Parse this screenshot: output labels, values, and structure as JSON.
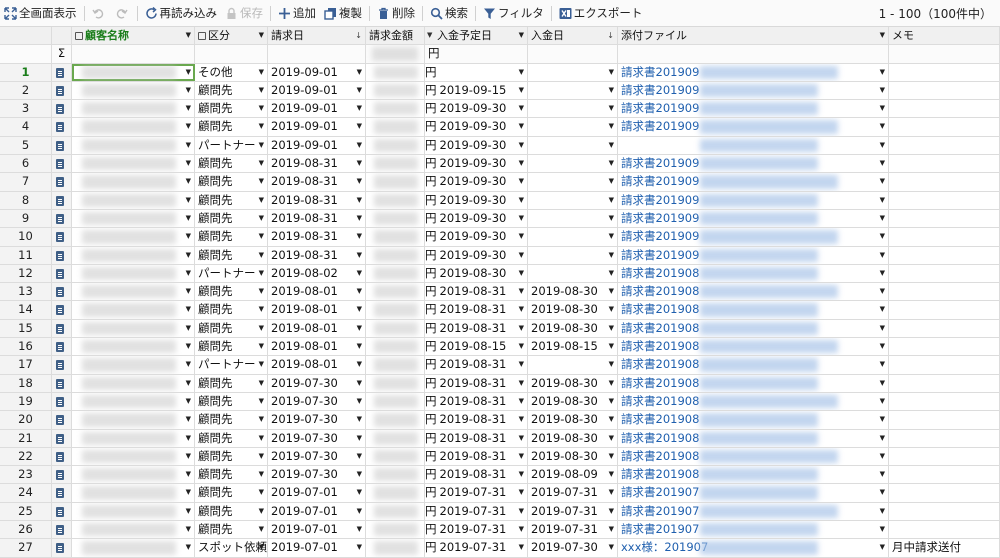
{
  "toolbar": {
    "fullscreen_label": "全画面表示",
    "reload_label": "再読み込み",
    "save_label": "保存",
    "add_label": "追加",
    "copy_label": "複製",
    "delete_label": "削除",
    "search_label": "検索",
    "filter_label": "フィルタ",
    "export_label": "エクスポート",
    "record_count": "1 - 100（100件中）"
  },
  "columns": {
    "customer": "顧客名称",
    "category": "区分",
    "invoice_date": "請求日",
    "amount": "請求金額",
    "due_date": "入金予定日",
    "paid_date": "入金日",
    "attachment": "添付ファイル",
    "memo": "メモ"
  },
  "summary": {
    "sigma": "Σ",
    "yen": "円"
  },
  "rows": [
    {
      "n": "1",
      "cat": "その他",
      "inv": "2019-09-01",
      "yen": "円",
      "due": "",
      "paid": "",
      "file": "請求書201909",
      "memo": ""
    },
    {
      "n": "2",
      "cat": "顧問先",
      "inv": "2019-09-01",
      "yen": "円",
      "due": "2019-09-15",
      "paid": "",
      "file": "請求書201909",
      "memo": ""
    },
    {
      "n": "3",
      "cat": "顧問先",
      "inv": "2019-09-01",
      "yen": "円",
      "due": "2019-09-30",
      "paid": "",
      "file": "請求書201909",
      "memo": ""
    },
    {
      "n": "4",
      "cat": "顧問先",
      "inv": "2019-09-01",
      "yen": "円",
      "due": "2019-09-30",
      "paid": "",
      "file": "請求書201909",
      "memo": ""
    },
    {
      "n": "5",
      "cat": "パートナー",
      "inv": "2019-09-01",
      "yen": "円",
      "due": "2019-09-30",
      "paid": "",
      "file": "",
      "memo": ""
    },
    {
      "n": "6",
      "cat": "顧問先",
      "inv": "2019-08-31",
      "yen": "円",
      "due": "2019-09-30",
      "paid": "",
      "file": "請求書201909",
      "memo": ""
    },
    {
      "n": "7",
      "cat": "顧問先",
      "inv": "2019-08-31",
      "yen": "円",
      "due": "2019-09-30",
      "paid": "",
      "file": "請求書201909",
      "memo": ""
    },
    {
      "n": "8",
      "cat": "顧問先",
      "inv": "2019-08-31",
      "yen": "円",
      "due": "2019-09-30",
      "paid": "",
      "file": "請求書201909",
      "memo": ""
    },
    {
      "n": "9",
      "cat": "顧問先",
      "inv": "2019-08-31",
      "yen": "円",
      "due": "2019-09-30",
      "paid": "",
      "file": "請求書201909",
      "memo": ""
    },
    {
      "n": "10",
      "cat": "顧問先",
      "inv": "2019-08-31",
      "yen": "円",
      "due": "2019-09-30",
      "paid": "",
      "file": "請求書201909",
      "memo": ""
    },
    {
      "n": "11",
      "cat": "顧問先",
      "inv": "2019-08-31",
      "yen": "円",
      "due": "2019-09-30",
      "paid": "",
      "file": "請求書201909",
      "memo": ""
    },
    {
      "n": "12",
      "cat": "パートナー",
      "inv": "2019-08-02",
      "yen": "円",
      "due": "2019-08-30",
      "paid": "",
      "file": "請求書201908",
      "memo": ""
    },
    {
      "n": "13",
      "cat": "顧問先",
      "inv": "2019-08-01",
      "yen": "円",
      "due": "2019-08-31",
      "paid": "2019-08-30",
      "file": "請求書201908",
      "memo": ""
    },
    {
      "n": "14",
      "cat": "顧問先",
      "inv": "2019-08-01",
      "yen": "円",
      "due": "2019-08-31",
      "paid": "2019-08-30",
      "file": "請求書201908",
      "memo": ""
    },
    {
      "n": "15",
      "cat": "顧問先",
      "inv": "2019-08-01",
      "yen": "円",
      "due": "2019-08-31",
      "paid": "2019-08-30",
      "file": "請求書201908",
      "memo": ""
    },
    {
      "n": "16",
      "cat": "顧問先",
      "inv": "2019-08-01",
      "yen": "円",
      "due": "2019-08-15",
      "paid": "2019-08-15",
      "file": "請求書201908",
      "memo": ""
    },
    {
      "n": "17",
      "cat": "パートナー",
      "inv": "2019-08-01",
      "yen": "円",
      "due": "2019-08-31",
      "paid": "",
      "file": "請求書201908",
      "memo": ""
    },
    {
      "n": "18",
      "cat": "顧問先",
      "inv": "2019-07-30",
      "yen": "円",
      "due": "2019-08-31",
      "paid": "2019-08-30",
      "file": "請求書201908",
      "memo": ""
    },
    {
      "n": "19",
      "cat": "顧問先",
      "inv": "2019-07-30",
      "yen": "円",
      "due": "2019-08-31",
      "paid": "2019-08-30",
      "file": "請求書201908",
      "memo": ""
    },
    {
      "n": "20",
      "cat": "顧問先",
      "inv": "2019-07-30",
      "yen": "円",
      "due": "2019-08-31",
      "paid": "2019-08-30",
      "file": "請求書201908",
      "memo": ""
    },
    {
      "n": "21",
      "cat": "顧問先",
      "inv": "2019-07-30",
      "yen": "円",
      "due": "2019-08-31",
      "paid": "2019-08-30",
      "file": "請求書201908",
      "memo": ""
    },
    {
      "n": "22",
      "cat": "顧問先",
      "inv": "2019-07-30",
      "yen": "円",
      "due": "2019-08-31",
      "paid": "2019-08-30",
      "file": "請求書201908",
      "memo": ""
    },
    {
      "n": "23",
      "cat": "顧問先",
      "inv": "2019-07-30",
      "yen": "円",
      "due": "2019-08-31",
      "paid": "2019-08-09",
      "file": "請求書201908",
      "memo": ""
    },
    {
      "n": "24",
      "cat": "顧問先",
      "inv": "2019-07-01",
      "yen": "円",
      "due": "2019-07-31",
      "paid": "2019-07-31",
      "file": "請求書201907",
      "memo": ""
    },
    {
      "n": "25",
      "cat": "顧問先",
      "inv": "2019-07-01",
      "yen": "円",
      "due": "2019-07-31",
      "paid": "2019-07-31",
      "file": "請求書201907",
      "memo": ""
    },
    {
      "n": "26",
      "cat": "顧問先",
      "inv": "2019-07-01",
      "yen": "円",
      "due": "2019-07-31",
      "paid": "2019-07-31",
      "file": "請求書201907",
      "memo": ""
    },
    {
      "n": "27",
      "cat": "スポット依頼",
      "inv": "2019-07-01",
      "yen": "円",
      "due": "2019-07-31",
      "paid": "2019-07-30",
      "file": "xxx様：201907",
      "memo": "月中請求送付"
    }
  ],
  "icons": {
    "fullscreen": "expand-arrows-icon",
    "undo": "undo-icon",
    "redo": "redo-icon",
    "reload": "reload-icon",
    "save": "lock-icon",
    "add": "plus-icon",
    "copy": "copy-icon",
    "delete": "trash-icon",
    "search": "magnifier-icon",
    "filter": "funnel-icon",
    "export": "excel-icon",
    "row_doc": "document-icon",
    "dropdown": "triangle-down-icon"
  },
  "colors": {
    "link": "#1f5fae",
    "active_row": "#1a7d1a",
    "toolbar_icon": "#3a5f95"
  }
}
